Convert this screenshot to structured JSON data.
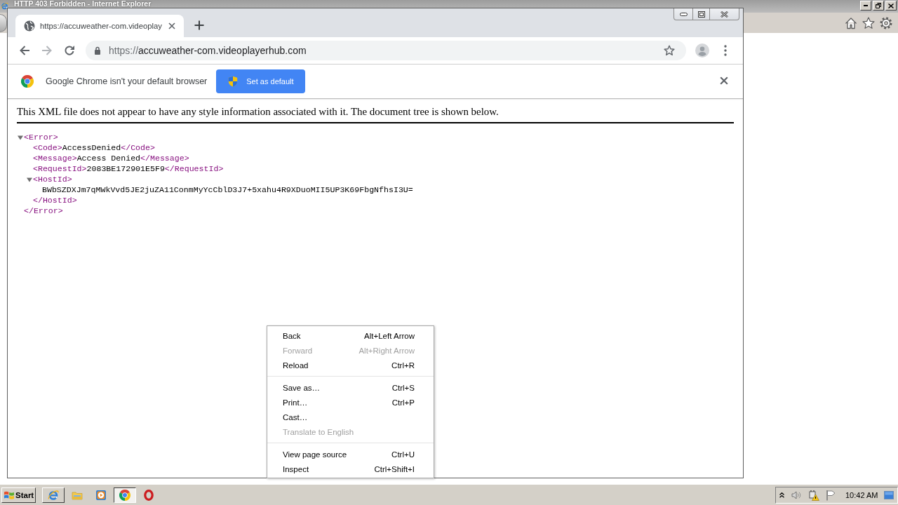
{
  "background_window": {
    "title": "HTTP 403 Forbidden - Internet Explorer"
  },
  "browser": {
    "tabs": [
      {
        "title": "https://accuweather-com.videoplay",
        "selected": true
      }
    ],
    "nav_buttons": [
      {
        "kind": "back",
        "disabled": false
      },
      {
        "kind": "forward",
        "disabled": true
      },
      {
        "kind": "reload",
        "disabled": false
      }
    ],
    "address_bar": {
      "scheme": "https://",
      "host": "accuweather-com.videoplayerhub.com"
    },
    "infobar": {
      "message": "Google Chrome isn't your default browser",
      "button": "Set as default"
    },
    "page": {
      "notice": "This XML file does not appear to have any style information associated with it. The document tree is shown below.",
      "xml_tree": [
        {
          "open": "<Error>",
          "close": "</Error>",
          "expanded": true,
          "children": [
            {
              "open": "<Code>",
              "text": "AccessDenied",
              "close": "</Code>"
            },
            {
              "open": "<Message>",
              "text": "Access Denied",
              "close": "</Message>"
            },
            {
              "open": "<RequestId>",
              "text": "2083BE172901E5F9",
              "close": "</RequestId>"
            },
            {
              "open": "<HostId>",
              "close": "</HostId>",
              "expanded": true,
              "children": [
                {
                  "text": "BWbSZDXJm7qMWkVvd5JE2juZA11ConmMyYcCblD3J7+5xahu4R9XDuoMII5UP3K69FbgNfhsI3U="
                }
              ]
            }
          ]
        }
      ]
    }
  },
  "context_menu": {
    "sections": [
      {
        "items": [
          {
            "label": "Back",
            "shortcut": "Alt+Left Arrow",
            "disabled": false
          },
          {
            "label": "Forward",
            "shortcut": "Alt+Right Arrow",
            "disabled": true
          },
          {
            "label": "Reload",
            "shortcut": "Ctrl+R",
            "disabled": false
          }
        ]
      },
      {
        "items": [
          {
            "label": "Save as…",
            "shortcut": "Ctrl+S",
            "disabled": false
          },
          {
            "label": "Print…",
            "shortcut": "Ctrl+P",
            "disabled": false
          },
          {
            "label": "Cast…",
            "disabled": false
          },
          {
            "label": "Translate to English",
            "disabled": true
          }
        ]
      },
      {
        "items": [
          {
            "label": "View page source",
            "shortcut": "Ctrl+U",
            "disabled": false
          },
          {
            "label": "Inspect",
            "shortcut": "Ctrl+Shift+I",
            "disabled": false
          }
        ]
      }
    ]
  },
  "taskbar": {
    "start": "Start",
    "items": [
      {
        "kind": "window",
        "selected": false
      },
      {
        "kind": "launcher",
        "selected": false
      },
      {
        "kind": "launcher",
        "selected": false
      },
      {
        "kind": "window",
        "selected": true
      },
      {
        "kind": "launcher",
        "selected": false
      }
    ],
    "clock": "10:42 AM"
  }
}
